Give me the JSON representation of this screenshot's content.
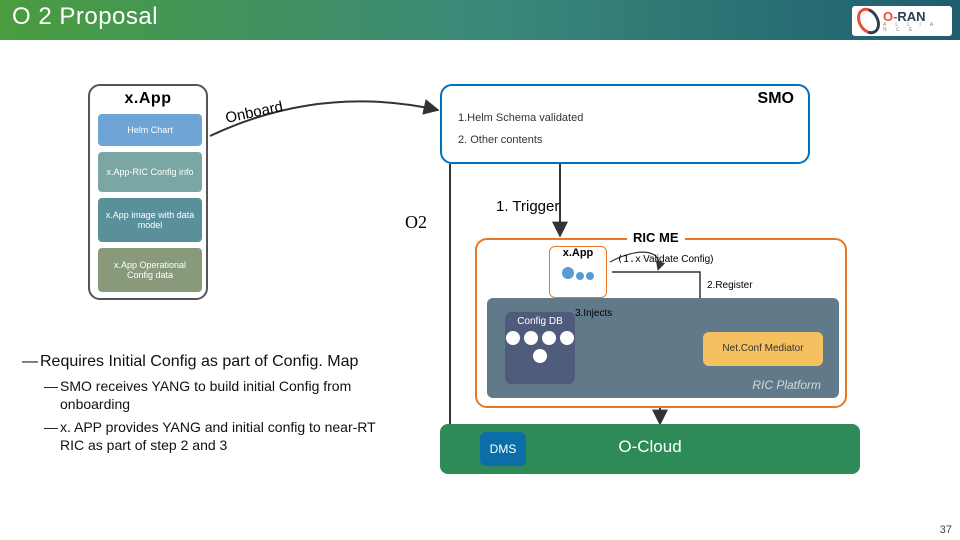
{
  "header": {
    "title": "O 2 Proposal",
    "logo_main": "RAN",
    "logo_prefix": "O-",
    "logo_sub": "A L L I A N C E"
  },
  "xapp_stack": {
    "title": "x.App",
    "cards": {
      "helm": "Helm Chart",
      "ric": "x.App-RIC Config info",
      "img": "x.App image with data model",
      "ops": "x.App Operational Config data"
    }
  },
  "smo": {
    "title": "SMO",
    "line1": "1.Helm Schema validated",
    "line2": "2. Other contents"
  },
  "ricme": {
    "title": "RIC ME",
    "xapp_label": "x.App",
    "platform_label": "RIC Platform",
    "configdb_label": "Config DB",
    "netconf_label": "Net.Conf Mediator",
    "step1x_num": "(1.x",
    "step1x_text": "Validate Config)",
    "step2": "2.Register",
    "step3": "3.Injects"
  },
  "ocloud": {
    "label": "O-Cloud",
    "dms": "DMS"
  },
  "connectors": {
    "onboard": "Onboard",
    "o2": "O2",
    "trigger": "1. Trigger"
  },
  "narrative": {
    "main": "Requires Initial Config as part of Config. Map",
    "subs": {
      "a": "SMO receives YANG to build initial Config from onboarding",
      "b": "x. APP provides YANG and initial config to near-RT RIC as part of step 2 and 3"
    }
  },
  "pagenum": "37"
}
